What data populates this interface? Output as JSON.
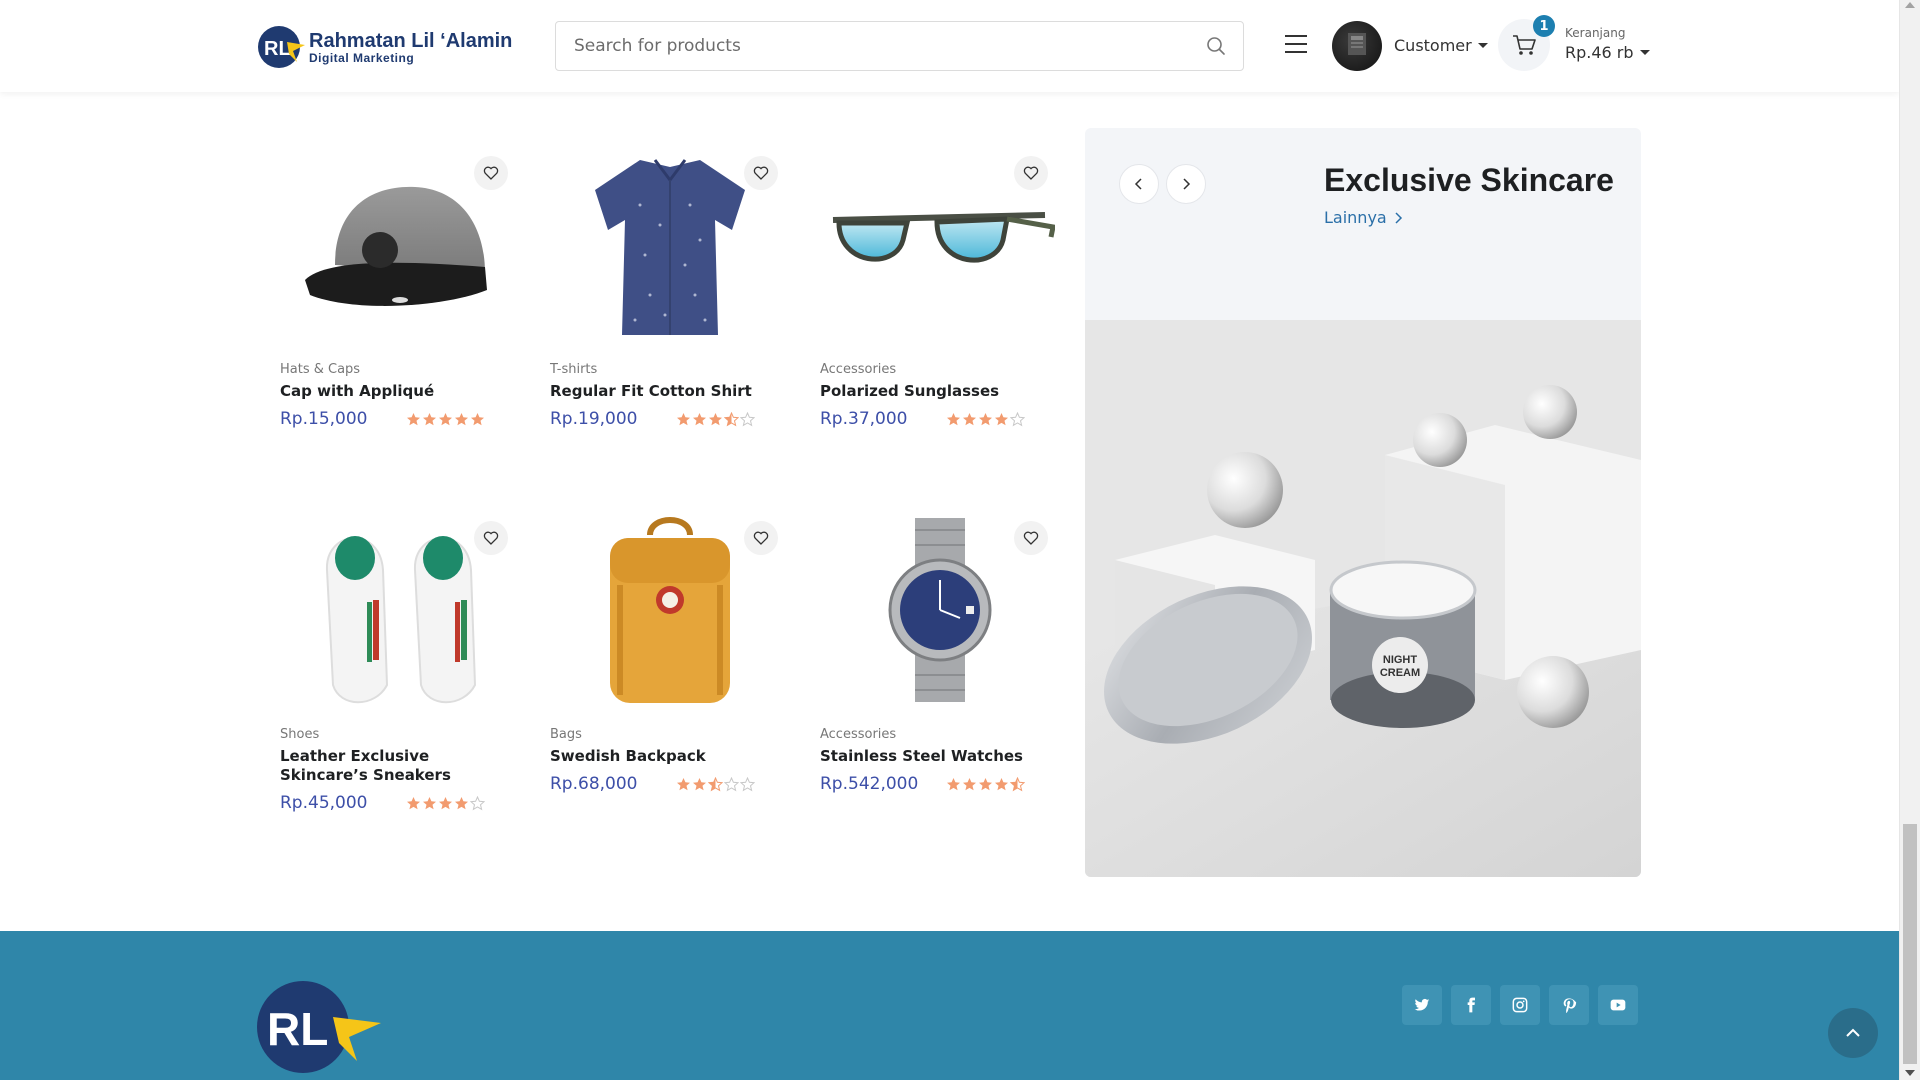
{
  "header": {
    "logo_title": "Rahmatan Lil ‘Alamin",
    "logo_subtitle": "Digital Marketing",
    "search_placeholder": "Search for products",
    "account_label": "Customer",
    "cart_badge": "1",
    "cart_label": "Keranjang",
    "cart_total": "Rp.46 rb"
  },
  "products": [
    {
      "category": "Hats & Caps",
      "name": "Cap with Appliqué",
      "price": "Rp.15,000",
      "rating": 5
    },
    {
      "category": "T-shirts",
      "name": "Regular Fit Cotton Shirt",
      "price": "Rp.19,000",
      "rating": 3.5
    },
    {
      "category": "Accessories",
      "name": "Polarized Sunglasses",
      "price": "Rp.37,000",
      "rating": 4
    },
    {
      "category": "Shoes",
      "name": "Leather Exclusive Skincare’s Sneakers",
      "price": "Rp.45,000",
      "rating": 4
    },
    {
      "category": "Bags",
      "name": "Swedish Backpack",
      "price": "Rp.68,000",
      "rating": 2.5
    },
    {
      "category": "Accessories",
      "name": "Stainless Steel Watches",
      "price": "Rp.542,000",
      "rating": 4.5
    }
  ],
  "promo": {
    "title": "Exclusive Skincare",
    "link_label": "Lainnya",
    "jar_label_line1": "NIGHT",
    "jar_label_line2": "CREAM"
  },
  "footer": {
    "socials": [
      "twitter-icon",
      "facebook-icon",
      "instagram-icon",
      "pinterest-icon",
      "youtube-icon"
    ]
  },
  "colors": {
    "accent": "#2f86a9",
    "price": "#3d4fa8",
    "star": "#f29b6f",
    "star_empty": "#c8c8c8"
  }
}
